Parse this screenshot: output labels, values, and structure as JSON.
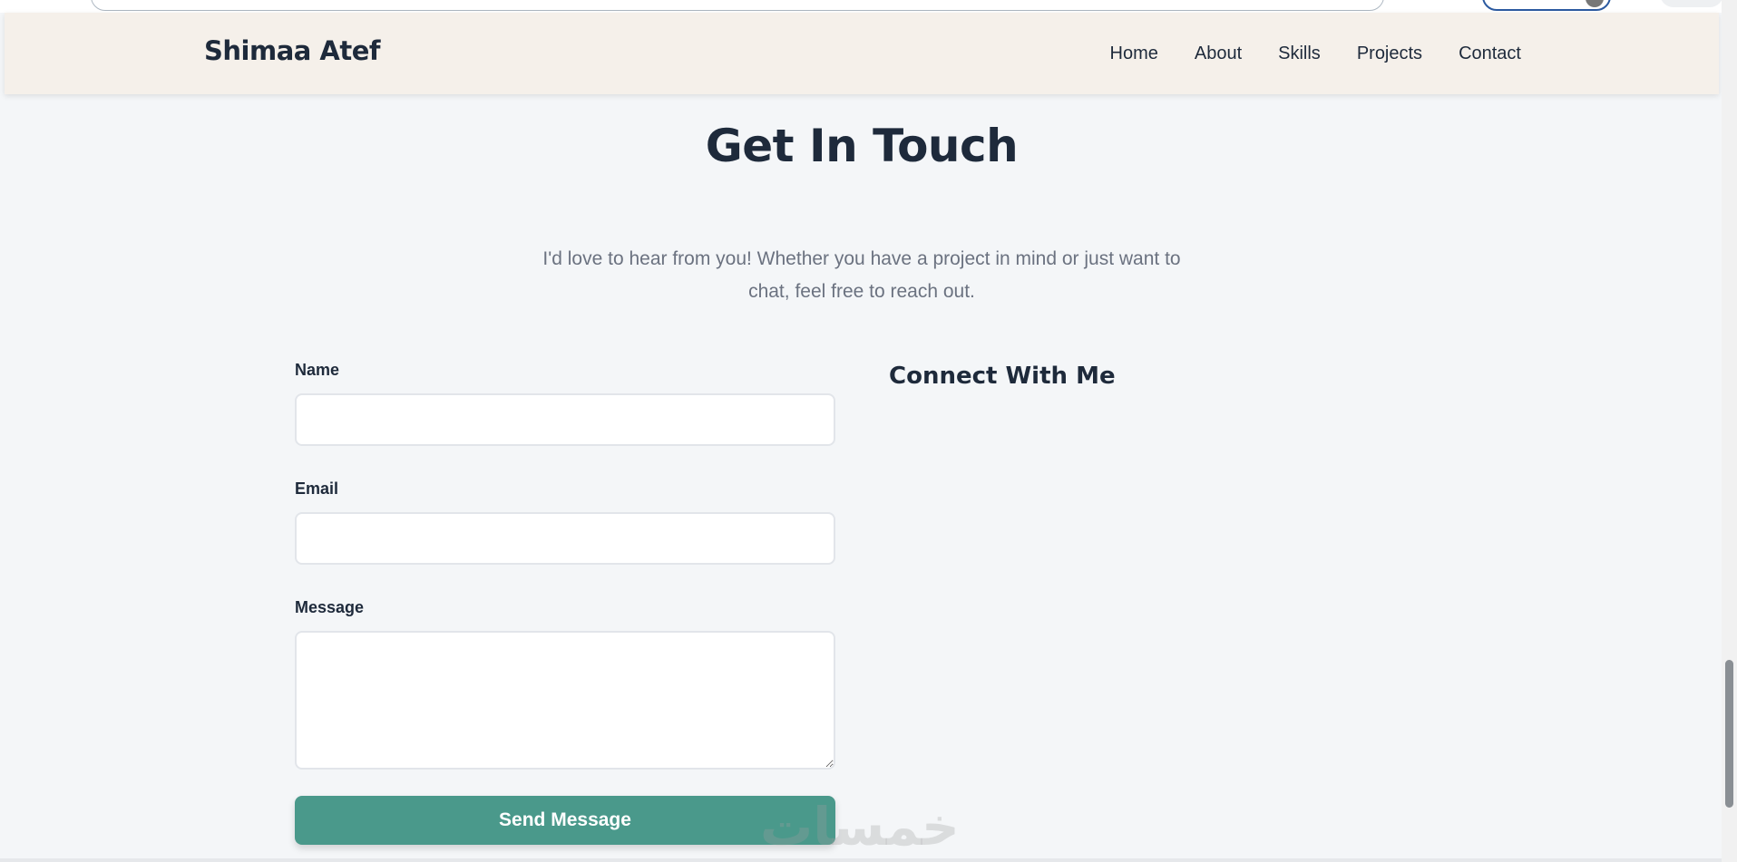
{
  "brand": {
    "name": "Shimaa Atef"
  },
  "nav": {
    "items": [
      {
        "label": "Home"
      },
      {
        "label": "About"
      },
      {
        "label": "Skills"
      },
      {
        "label": "Projects"
      },
      {
        "label": "Contact"
      }
    ]
  },
  "contact": {
    "title": "Get In Touch",
    "subtitle": "I'd love to hear from you! Whether you have a project in mind or just want to chat, feel free to reach out.",
    "form": {
      "name_label": "Name",
      "name_value": "",
      "email_label": "Email",
      "email_value": "",
      "message_label": "Message",
      "message_value": "",
      "submit_label": "Send Message"
    },
    "connect_title": "Connect With Me"
  },
  "watermark": {
    "text": "خمسات"
  },
  "colors": {
    "navbar_bg": "#f5f0ea",
    "page_bg": "#f4f6f8",
    "text_dark": "#1e2a3b",
    "text_muted": "#6b7280",
    "accent": "#4a998b"
  }
}
